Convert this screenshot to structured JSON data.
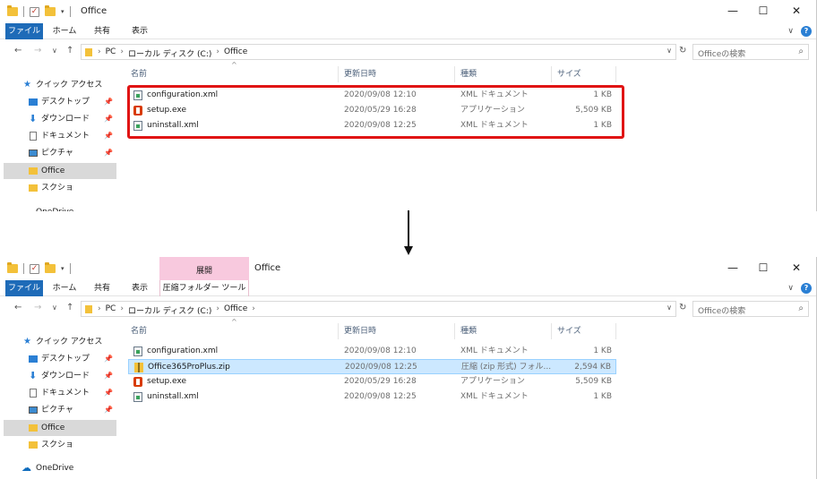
{
  "window1": {
    "title": "Office",
    "controls": {
      "minimize": "—",
      "maximize": "☐",
      "close": "✕"
    },
    "ribbon_tabs": [
      "ファイル",
      "ホーム",
      "共有",
      "表示"
    ],
    "breadcrumb": [
      "PC",
      "ローカル ディスク (C:)",
      "Office"
    ],
    "search_placeholder": "Officeの検索",
    "sidebar": [
      {
        "label": "クイック アクセス",
        "icon": "star-icon",
        "pinned": false
      },
      {
        "label": "デスクトップ",
        "icon": "desktop-icon",
        "pinned": true
      },
      {
        "label": "ダウンロード",
        "icon": "download-icon",
        "pinned": true
      },
      {
        "label": "ドキュメント",
        "icon": "document-icon",
        "pinned": true
      },
      {
        "label": "ピクチャ",
        "icon": "pictures-icon",
        "pinned": true
      },
      {
        "label": "Office",
        "icon": "folder-icon",
        "pinned": false,
        "selected": true
      },
      {
        "label": "スクショ",
        "icon": "folder-icon",
        "pinned": false
      },
      {
        "label": "OneDrive",
        "icon": "cloud-icon",
        "pinned": false
      }
    ],
    "columns": [
      "名前",
      "更新日時",
      "種類",
      "サイズ"
    ],
    "files": [
      {
        "name": "configuration.xml",
        "date": "2020/09/08 12:10",
        "type": "XML ドキュメント",
        "size": "1 KB",
        "icon": "xml-file-icon"
      },
      {
        "name": "setup.exe",
        "date": "2020/05/29 16:28",
        "type": "アプリケーション",
        "size": "5,509 KB",
        "icon": "office-exe-icon"
      },
      {
        "name": "uninstall.xml",
        "date": "2020/09/08 12:25",
        "type": "XML ドキュメント",
        "size": "1 KB",
        "icon": "xml-file-icon"
      }
    ],
    "highlight_color": "#e01414"
  },
  "window2": {
    "title": "Office",
    "context_group": "展開",
    "context_tab": "圧縮フォルダー ツール",
    "controls": {
      "minimize": "—",
      "maximize": "☐",
      "close": "✕"
    },
    "ribbon_tabs": [
      "ファイル",
      "ホーム",
      "共有",
      "表示"
    ],
    "breadcrumb": [
      "PC",
      "ローカル ディスク (C:)",
      "Office"
    ],
    "search_placeholder": "Officeの検索",
    "sidebar": [
      {
        "label": "クイック アクセス",
        "icon": "star-icon",
        "pinned": false
      },
      {
        "label": "デスクトップ",
        "icon": "desktop-icon",
        "pinned": true
      },
      {
        "label": "ダウンロード",
        "icon": "download-icon",
        "pinned": true
      },
      {
        "label": "ドキュメント",
        "icon": "document-icon",
        "pinned": true
      },
      {
        "label": "ピクチャ",
        "icon": "pictures-icon",
        "pinned": true
      },
      {
        "label": "Office",
        "icon": "folder-icon",
        "pinned": false,
        "selected": true
      },
      {
        "label": "スクショ",
        "icon": "folder-icon",
        "pinned": false
      },
      {
        "label": "OneDrive",
        "icon": "cloud-icon",
        "pinned": false
      }
    ],
    "columns": [
      "名前",
      "更新日時",
      "種類",
      "サイズ"
    ],
    "files": [
      {
        "name": "configuration.xml",
        "date": "2020/09/08 12:10",
        "type": "XML ドキュメント",
        "size": "1 KB",
        "icon": "xml-file-icon"
      },
      {
        "name": "Office365ProPlus.zip",
        "date": "2020/09/08 12:25",
        "type": "圧縮 (zip 形式) フォル...",
        "size": "2,594 KB",
        "icon": "zip-folder-icon",
        "selected": true
      },
      {
        "name": "setup.exe",
        "date": "2020/05/29 16:28",
        "type": "アプリケーション",
        "size": "5,509 KB",
        "icon": "office-exe-icon"
      },
      {
        "name": "uninstall.xml",
        "date": "2020/09/08 12:25",
        "type": "XML ドキュメント",
        "size": "1 KB",
        "icon": "xml-file-icon"
      }
    ]
  },
  "colors": {
    "file_tab": "#1e6bb8",
    "selection": "#cce8ff",
    "context_tab": "#f8c9de"
  }
}
